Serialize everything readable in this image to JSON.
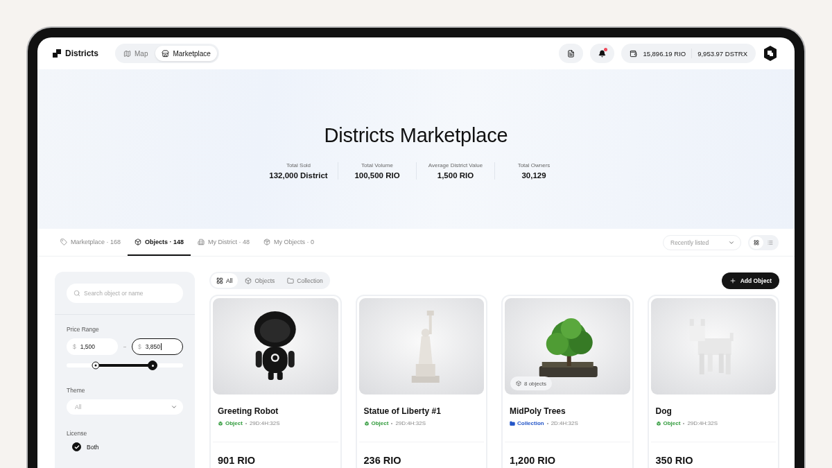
{
  "brand": {
    "name": "Districts"
  },
  "nav": [
    {
      "label": "Map",
      "kind": "map",
      "selected": false
    },
    {
      "label": "Marketplace",
      "kind": "store",
      "selected": true
    }
  ],
  "header": {
    "notification_unread": true,
    "balances": [
      "15,896.19 RIO",
      "9,953.97 DSTRX"
    ]
  },
  "hero": {
    "title": "Districts Marketplace",
    "stats": [
      {
        "label": "Total Sold",
        "value": "132,000 District"
      },
      {
        "label": "Total Volume",
        "value": "100,500 RIO"
      },
      {
        "label": "Average District Value",
        "value": "1,500 RIO"
      },
      {
        "label": "Total Owners",
        "value": "30,129"
      }
    ]
  },
  "tabs": [
    {
      "label": "Marketplace · 168",
      "kind": "tag",
      "selected": false
    },
    {
      "label": "Objects · 148",
      "kind": "cube",
      "selected": true
    },
    {
      "label": "My District · 48",
      "kind": "building",
      "selected": false
    },
    {
      "label": "My Objects · 0",
      "kind": "box",
      "selected": false
    }
  ],
  "sort": {
    "value": "Recently listed"
  },
  "view": [
    {
      "kind": "grid",
      "selected": true
    },
    {
      "kind": "list",
      "selected": false
    }
  ],
  "filters": {
    "search": {
      "placeholder": "Search object or name"
    },
    "price": {
      "label": "Price Range",
      "min": {
        "prefix": "$",
        "value": "1,500",
        "focused": false
      },
      "max": {
        "prefix": "$",
        "value": "3,850",
        "focused": true
      },
      "thumbs": [
        {
          "level": 0.25
        },
        {
          "level": 0.74
        }
      ]
    },
    "theme": {
      "label": "Theme",
      "value": "All"
    },
    "license": {
      "label": "License",
      "options": [
        {
          "label": "Both",
          "checked": true
        }
      ]
    }
  },
  "type_filter": [
    {
      "label": "All",
      "kind": "grid",
      "selected": true
    },
    {
      "label": "Objects",
      "kind": "cube",
      "selected": false
    },
    {
      "label": "Collection",
      "kind": "folder",
      "selected": false
    }
  ],
  "add_button": {
    "label": "Add Object"
  },
  "items": [
    {
      "name": "Greeting Robot",
      "type": "Object",
      "kind": "object",
      "color": "#2f9a3a",
      "time": "29D:4H:32S",
      "price": "901 RIO"
    },
    {
      "name": "Statue of Liberty #1",
      "type": "Object",
      "kind": "object",
      "color": "#2f9a3a",
      "time": "29D:4H:32S",
      "price": "236 RIO"
    },
    {
      "name": "MidPoly Trees",
      "type": "Collection",
      "kind": "collection",
      "color": "#2456c8",
      "time": "2D:4H:32S",
      "price": "1,200 RIO",
      "badge": "8 objects"
    },
    {
      "name": "Dog",
      "type": "Object",
      "kind": "object",
      "color": "#2f9a3a",
      "time": "29D:4H:32S",
      "price": "350 RIO"
    }
  ]
}
